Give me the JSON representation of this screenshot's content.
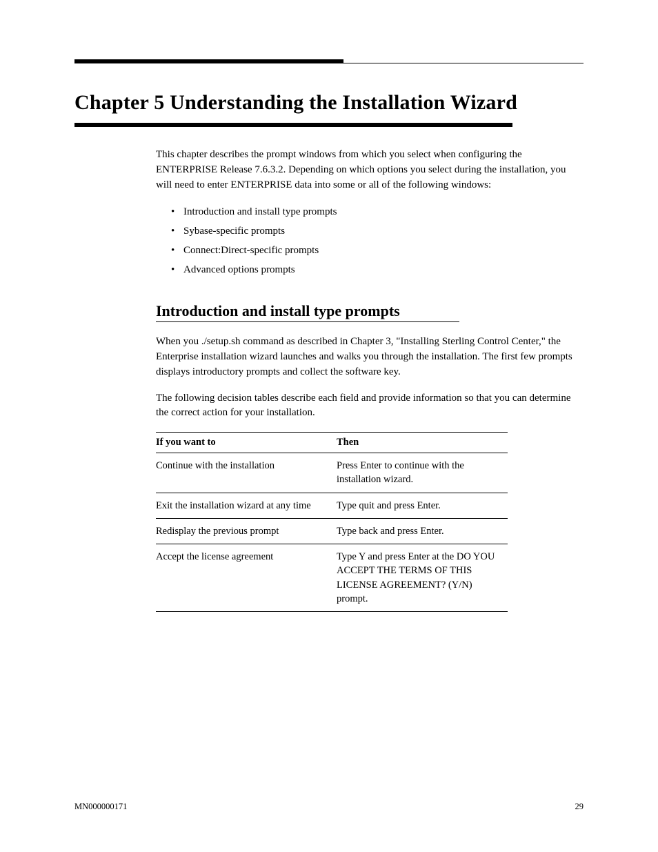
{
  "chapter": {
    "label": "Chapter 5",
    "title": "Understanding the Installation Wizard"
  },
  "intro": "This chapter describes the prompt windows from which you select when configuring the ENTERPRISE Release 7.6.3.2. Depending on which options you select during the installation, you will need to enter ENTERPRISE data into some or all of the following windows:",
  "bullets": [
    "Introduction and install type prompts",
    "Sybase-specific prompts",
    "Connect:Direct-specific prompts",
    "Advanced options prompts"
  ],
  "section": {
    "title": "Introduction and install type prompts",
    "para1": "When you ./setup.sh command as described in Chapter 3, \"Installing Sterling Control Center,\" the Enterprise installation wizard launches and walks you through the installation. The first few prompts displays introductory prompts and collect the software key.",
    "para2": "The following decision tables describe each field and provide information so that you can determine the correct action for your installation."
  },
  "table": {
    "headers": [
      "If you want to",
      "Then"
    ],
    "rows": [
      {
        "c1": "Continue with the installation",
        "c2": "Press Enter to continue with the installation wizard."
      },
      {
        "c1": "Exit the installation wizard at any time",
        "c2": "Type quit and press Enter."
      },
      {
        "c1": "Redisplay the previous prompt",
        "c2": "Type back and press Enter."
      },
      {
        "c1": "Accept the license agreement",
        "c2": "Type Y and press Enter at the DO YOU ACCEPT THE TERMS OF THIS LICENSE AGREEMENT? (Y/N) prompt."
      }
    ]
  },
  "footer": {
    "left": "MN000000171",
    "right": "29"
  }
}
